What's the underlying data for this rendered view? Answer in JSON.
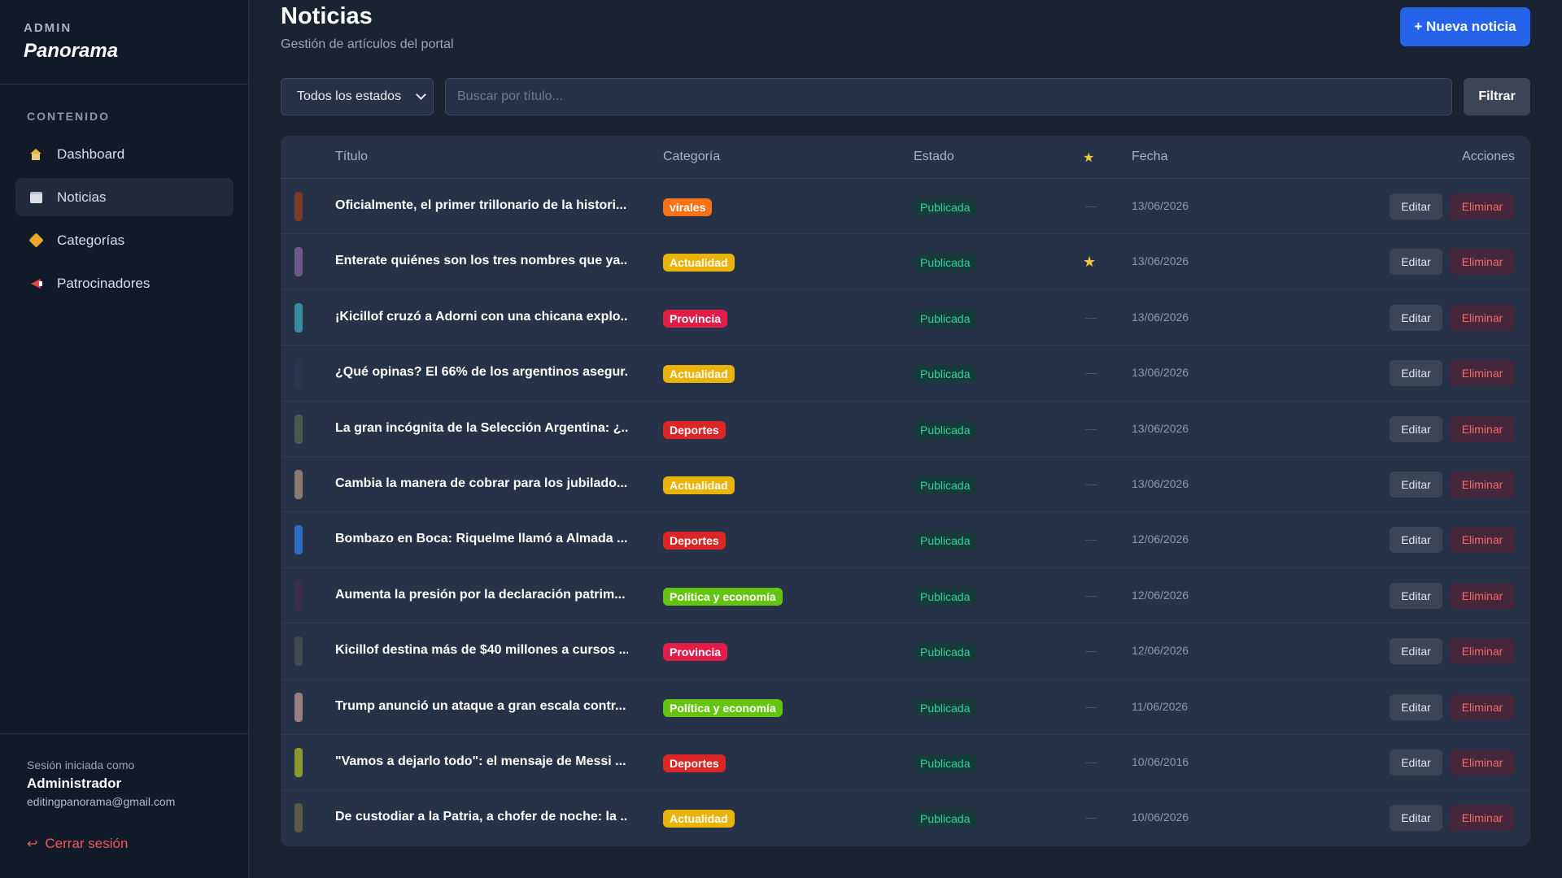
{
  "sidebar": {
    "admin_label": "ADMIN",
    "brand": "Panorama",
    "section": "CONTENIDO",
    "items": [
      {
        "label": "Dashboard",
        "icon": "home-icon"
      },
      {
        "label": "Noticias",
        "icon": "newspaper-icon",
        "active": true
      },
      {
        "label": "Categorías",
        "icon": "tag-icon"
      },
      {
        "label": "Patrocinadores",
        "icon": "megaphone-icon"
      }
    ],
    "footer": {
      "session_label": "Sesión iniciada como",
      "user": "Administrador",
      "email": "editingpanorama@gmail.com",
      "logout": "Cerrar sesión"
    }
  },
  "header": {
    "title": "Noticias",
    "subtitle": "Gestión de artículos del portal",
    "new_button": "+ Nueva noticia"
  },
  "filters": {
    "status_select": "Todos los estados",
    "search_placeholder": "Buscar por título...",
    "filter_button": "Filtrar"
  },
  "table": {
    "columns": {
      "title": "Título",
      "category": "Categoría",
      "status": "Estado",
      "featured": "★",
      "date": "Fecha",
      "actions": "Acciones"
    },
    "edit_label": "Editar",
    "delete_label": "Eliminar",
    "rows": [
      {
        "title": "Oficialmente, el primer trillonario de la histori...",
        "category": "virales",
        "cat_color": "#f97316",
        "status": "Publicada",
        "featured": false,
        "date": "13/06/2026",
        "thumb": "#7a3b2a"
      },
      {
        "title": "Enterate quiénes son los tres nombres que ya...",
        "category": "Actualidad",
        "cat_color": "#eab308",
        "status": "Publicada",
        "featured": true,
        "date": "13/06/2026",
        "thumb": "#6b5a8a"
      },
      {
        "title": "¡Kicillof cruzó a Adorni con una chicana explo...",
        "category": "Provincia",
        "cat_color": "#e11d48",
        "status": "Publicada",
        "featured": false,
        "date": "13/06/2026",
        "thumb": "#3a8aa0"
      },
      {
        "title": "¿Qué opinas? El 66% de los argentinos asegur...",
        "category": "Actualidad",
        "cat_color": "#eab308",
        "status": "Publicada",
        "featured": false,
        "date": "13/06/2026",
        "thumb": "#2b3550"
      },
      {
        "title": "La gran incógnita de la Selección Argentina: ¿...",
        "category": "Deportes",
        "cat_color": "#dc2626",
        "status": "Publicada",
        "featured": false,
        "date": "13/06/2026",
        "thumb": "#4a5a50"
      },
      {
        "title": "Cambia la manera de cobrar para los jubilado...",
        "category": "Actualidad",
        "cat_color": "#eab308",
        "status": "Publicada",
        "featured": false,
        "date": "13/06/2026",
        "thumb": "#8a7a70"
      },
      {
        "title": "Bombazo en Boca: Riquelme llamó a Almada ...",
        "category": "Deportes",
        "cat_color": "#dc2626",
        "status": "Publicada",
        "featured": false,
        "date": "12/06/2026",
        "thumb": "#2f6fc0"
      },
      {
        "title": "Aumenta la presión por la declaración patrim...",
        "category": "Política y economía",
        "cat_color": "#65c40f",
        "status": "Publicada",
        "featured": false,
        "date": "12/06/2026",
        "thumb": "#3a2e4a"
      },
      {
        "title": "Kicillof destina más de $40 millones a cursos ...",
        "category": "Provincia",
        "cat_color": "#e11d48",
        "status": "Publicada",
        "featured": false,
        "date": "12/06/2026",
        "thumb": "#404a55"
      },
      {
        "title": "Trump anunció un ataque a gran escala contr...",
        "category": "Política y economía",
        "cat_color": "#65c40f",
        "status": "Publicada",
        "featured": false,
        "date": "11/06/2026",
        "thumb": "#9a7f80"
      },
      {
        "title": "\"Vamos a dejarlo todo\": el mensaje de Messi ...",
        "category": "Deportes",
        "cat_color": "#dc2626",
        "status": "Publicada",
        "featured": false,
        "date": "10/06/2016",
        "thumb": "#8a9a30"
      },
      {
        "title": "De custodiar a la Patria, a chofer de noche: la ...",
        "category": "Actualidad",
        "cat_color": "#eab308",
        "status": "Publicada",
        "featured": false,
        "date": "10/06/2026",
        "thumb": "#5a5a48"
      }
    ]
  },
  "colors": {
    "accent": "#2563eb",
    "status_green": "#34d399",
    "danger": "#f56a6a",
    "star": "#f5c542"
  }
}
